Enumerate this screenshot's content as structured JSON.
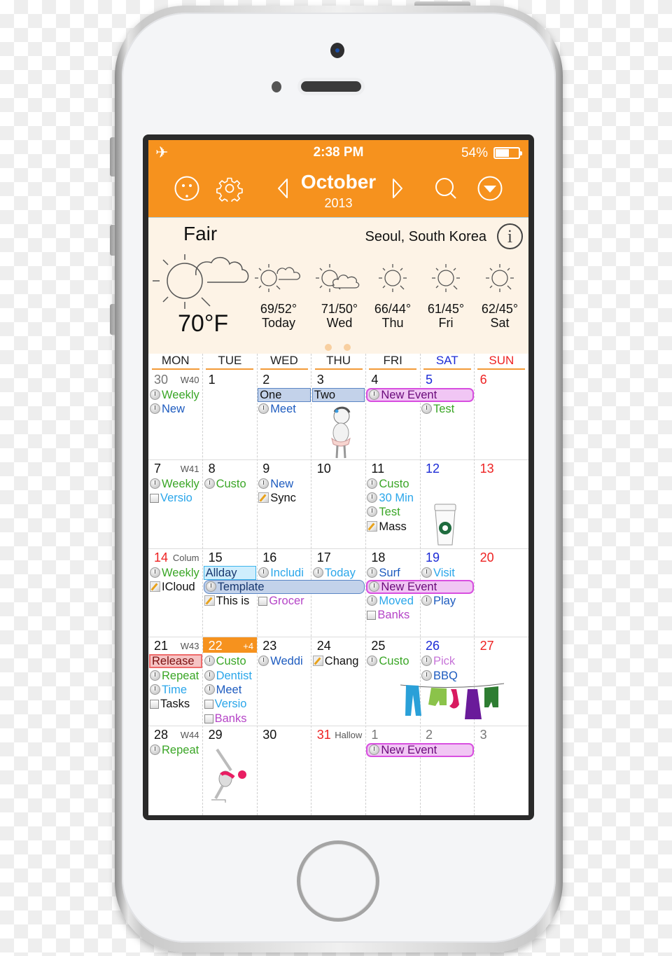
{
  "status_bar": {
    "airplane_icon": "airplane-icon",
    "time": "2:38 PM",
    "battery_percent": "54%",
    "battery_level": 0.54
  },
  "nav": {
    "month": "October",
    "year": "2013",
    "icons": [
      "smiley-icon",
      "gear-icon",
      "chevron-left-icon",
      "chevron-right-icon",
      "search-icon",
      "dropdown-circle-icon"
    ]
  },
  "weather": {
    "condition": "Fair",
    "location": "Seoul, South Korea",
    "current_temp": "70°F",
    "info_label": "i",
    "forecast": [
      {
        "hilo": "69/52°",
        "day": "Today",
        "icon": "sun-cloud-icon"
      },
      {
        "hilo": "71/50°",
        "day": "Wed",
        "icon": "partly-cloudy-icon"
      },
      {
        "hilo": "66/44°",
        "day": "Thu",
        "icon": "sun-icon"
      },
      {
        "hilo": "61/45°",
        "day": "Fri",
        "icon": "sun-icon"
      },
      {
        "hilo": "62/45°",
        "day": "Sat",
        "icon": "sun-icon"
      }
    ],
    "pages": 2,
    "active_page": 1
  },
  "calendar": {
    "weekdays": [
      "MON",
      "TUE",
      "WED",
      "THU",
      "FRI",
      "SAT",
      "SUN"
    ],
    "weeks": [
      {
        "days": [
          {
            "num": "30",
            "label": "W40",
            "style": "grey",
            "events": [
              {
                "icon": "clock",
                "text": "Weekly",
                "color": "green"
              },
              {
                "icon": "clock",
                "text": "New",
                "color": "blue"
              }
            ]
          },
          {
            "num": "1",
            "events": []
          },
          {
            "num": "2",
            "events": [
              {
                "slot": 1,
                "icon": "clock",
                "text": "Meet",
                "color": "blue"
              }
            ]
          },
          {
            "num": "3",
            "events": [],
            "sticker": "baby-sticker"
          },
          {
            "num": "4",
            "events": []
          },
          {
            "num": "5",
            "style": "sat",
            "events": [
              {
                "slot": 1,
                "icon": "clock",
                "text": "Test",
                "color": "green"
              }
            ]
          },
          {
            "num": "6",
            "style": "sun",
            "events": []
          }
        ],
        "bars": [
          {
            "text": "One",
            "start": 2,
            "span": 1,
            "slot": 0,
            "style": "blue"
          },
          {
            "text": "Two",
            "start": 3,
            "span": 1,
            "slot": 0,
            "style": "blue"
          },
          {
            "text": "New Event",
            "start": 4,
            "span": 2,
            "slot": 0,
            "style": "purple",
            "icon": "clock"
          }
        ]
      },
      {
        "days": [
          {
            "num": "7",
            "label": "W41",
            "events": [
              {
                "icon": "clock",
                "text": "Weekly",
                "color": "green"
              },
              {
                "icon": "check",
                "text": "Versio",
                "color": "cyan"
              }
            ]
          },
          {
            "num": "8",
            "events": [
              {
                "icon": "clock",
                "text": "Custo",
                "color": "green"
              }
            ]
          },
          {
            "num": "9",
            "events": [
              {
                "icon": "clock",
                "text": "New",
                "color": "blue"
              },
              {
                "icon": "note",
                "text": "Sync",
                "color": "black"
              }
            ]
          },
          {
            "num": "10",
            "events": []
          },
          {
            "num": "11",
            "events": [
              {
                "icon": "clock",
                "text": "Custo",
                "color": "green"
              },
              {
                "icon": "clock",
                "text": "30 Min",
                "color": "cyan"
              },
              {
                "icon": "clock",
                "text": "Test",
                "color": "green"
              },
              {
                "icon": "note",
                "text": "Mass",
                "color": "black"
              }
            ]
          },
          {
            "num": "12",
            "style": "sat",
            "events": [],
            "sticker": "coffee-cup-sticker"
          },
          {
            "num": "13",
            "style": "sun",
            "events": []
          }
        ],
        "bars": []
      },
      {
        "days": [
          {
            "num": "14",
            "label": "Colum",
            "style": "sun",
            "events": [
              {
                "icon": "clock",
                "text": "Weekly",
                "color": "green"
              },
              {
                "icon": "note",
                "text": "ICloud",
                "color": "black"
              }
            ]
          },
          {
            "num": "15",
            "events": [
              {
                "slot": 2,
                "icon": "note",
                "text": "This is",
                "color": "black"
              }
            ]
          },
          {
            "num": "16",
            "events": [
              {
                "icon": "clock",
                "text": "Includi",
                "color": "cyan"
              },
              {
                "slot": 2,
                "icon": "check",
                "text": "Grocer",
                "color": "purple"
              }
            ]
          },
          {
            "num": "17",
            "events": [
              {
                "icon": "clock",
                "text": "Today",
                "color": "cyan"
              }
            ]
          },
          {
            "num": "18",
            "events": [
              {
                "icon": "clock",
                "text": "Surf",
                "color": "blue"
              },
              {
                "slot": 2,
                "icon": "clock",
                "text": "Moved",
                "color": "cyan"
              },
              {
                "slot": 3,
                "icon": "check",
                "text": "Banks",
                "color": "purple"
              }
            ]
          },
          {
            "num": "19",
            "style": "sat",
            "events": [
              {
                "icon": "clock",
                "text": "Visit",
                "color": "cyan"
              },
              {
                "slot": 2,
                "icon": "clock",
                "text": "Play",
                "color": "blue"
              }
            ]
          },
          {
            "num": "20",
            "style": "sun",
            "events": []
          }
        ],
        "bars": [
          {
            "text": "Allday",
            "start": 1,
            "span": 1,
            "slot": 0,
            "style": "cyan"
          },
          {
            "text": "Template",
            "start": 1,
            "span": 3,
            "slot": 1,
            "style": "bluer",
            "icon": "clock"
          },
          {
            "text": "New Event",
            "start": 4,
            "span": 2,
            "slot": 1,
            "style": "purple",
            "icon": "clock"
          }
        ]
      },
      {
        "days": [
          {
            "num": "21",
            "label": "W43",
            "events": [
              {
                "slot": 1,
                "icon": "clock",
                "text": "Repeat",
                "color": "green"
              },
              {
                "slot": 2,
                "icon": "clock",
                "text": "Time",
                "color": "cyan"
              },
              {
                "slot": 3,
                "icon": "check",
                "text": "Tasks",
                "color": "black"
              }
            ]
          },
          {
            "num": "22",
            "label": "+4",
            "today": true,
            "events": [
              {
                "icon": "clock",
                "text": "Custo",
                "color": "green"
              },
              {
                "icon": "clock",
                "text": "Dentist",
                "color": "cyan"
              },
              {
                "icon": "clock",
                "text": "Meet",
                "color": "blue"
              },
              {
                "icon": "check",
                "text": "Versio",
                "color": "cyan"
              },
              {
                "icon": "check",
                "text": "Banks",
                "color": "purple"
              }
            ]
          },
          {
            "num": "23",
            "events": [
              {
                "icon": "clock",
                "text": "Weddi",
                "color": "blue"
              }
            ]
          },
          {
            "num": "24",
            "events": [
              {
                "icon": "note",
                "text": "Chang",
                "color": "black"
              }
            ]
          },
          {
            "num": "25",
            "events": [
              {
                "icon": "clock",
                "text": "Custo",
                "color": "green"
              }
            ]
          },
          {
            "num": "26",
            "style": "sat",
            "events": [
              {
                "icon": "clock",
                "text": "Pick",
                "color": "violet"
              },
              {
                "icon": "clock",
                "text": "BBQ",
                "color": "blue"
              }
            ]
          },
          {
            "num": "27",
            "style": "sun",
            "events": []
          }
        ],
        "bars": [
          {
            "text": "Release",
            "start": 0,
            "span": 1,
            "slot": 0,
            "style": "red"
          }
        ],
        "sticker": "clothesline-sticker"
      },
      {
        "days": [
          {
            "num": "28",
            "label": "W44",
            "events": [
              {
                "icon": "clock",
                "text": "Repeat",
                "color": "green"
              }
            ]
          },
          {
            "num": "29",
            "events": [],
            "sticker": "swimmer-sticker"
          },
          {
            "num": "30",
            "events": []
          },
          {
            "num": "31",
            "label": "Hallow",
            "style": "sun",
            "events": []
          },
          {
            "num": "1",
            "style": "grey",
            "events": []
          },
          {
            "num": "2",
            "style": "grey",
            "events": []
          },
          {
            "num": "3",
            "style": "grey",
            "events": []
          }
        ],
        "bars": [
          {
            "text": "New Event",
            "start": 4,
            "span": 2,
            "slot": 0,
            "style": "purple",
            "icon": "clock"
          }
        ]
      }
    ]
  }
}
